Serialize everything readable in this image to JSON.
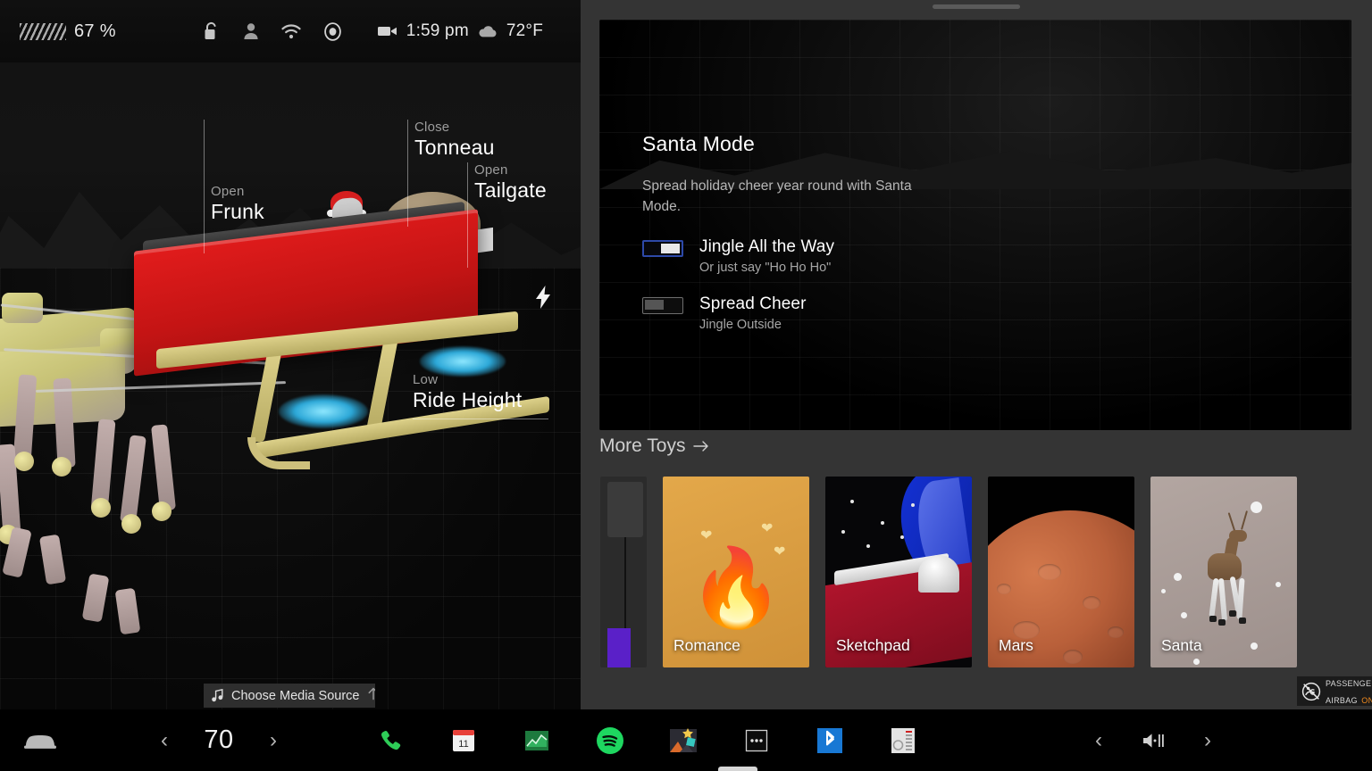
{
  "status_bar": {
    "battery_percent": "67 %",
    "battery_icon": "battery-hatch-icon",
    "lock_icon": "unlocked-padlock-icon",
    "profile_icon": "driver-profile-icon",
    "wifi_icon": "wifi-icon",
    "sentry_icon": "sentry-mode-camera-icon",
    "dashcam_icon": "dashcam-video-icon",
    "time": "1:59 pm",
    "weather_icon": "cloud-icon",
    "temperature": "72°F"
  },
  "vehicle_view": {
    "hotspots": [
      {
        "action": "Open",
        "label": "Frunk"
      },
      {
        "action": "Close",
        "label": "Tonneau"
      },
      {
        "action": "Open",
        "label": "Tailgate"
      },
      {
        "action": "Low",
        "label": "Ride Height"
      }
    ],
    "charge_port_icon": "lightning-bolt-icon"
  },
  "media_source": {
    "icon": "music-note-icon",
    "label": "Choose Media Source",
    "expand_icon": "chevron-up-icon"
  },
  "santa_mode": {
    "title": "Santa Mode",
    "description": "Spread holiday cheer year round with Santa Mode.",
    "toggles": [
      {
        "label": "Jingle All the Way",
        "sub": "Or just say \"Ho Ho Ho\"",
        "state": "on"
      },
      {
        "label": "Spread Cheer",
        "sub": "Jingle Outside",
        "state": "off"
      }
    ]
  },
  "more_toys": {
    "label": "More Toys",
    "arrow_icon": "arrow-right-icon",
    "cards": [
      {
        "title": "",
        "kind": "partial"
      },
      {
        "title": "Romance",
        "kind": "romance"
      },
      {
        "title": "Sketchpad",
        "kind": "sketchpad"
      },
      {
        "title": "Mars",
        "kind": "mars"
      },
      {
        "title": "Santa",
        "kind": "santa"
      }
    ]
  },
  "airbag_indicator": {
    "icon": "passenger-airbag-off-symbol-icon",
    "line1": "PASSENGER",
    "line2": "AIRBAG",
    "state": "ON",
    "state_color": "#f08a1e"
  },
  "bottom_bar": {
    "car_icon": "car-front-icon",
    "driver_temp": {
      "decrease_icon": "chevron-left-icon",
      "value": "70",
      "increase_icon": "chevron-right-icon"
    },
    "apps": [
      {
        "name": "phone",
        "icon": "phone-handset-icon",
        "color": "#2ecc57",
        "label": ""
      },
      {
        "name": "calendar",
        "icon": "calendar-icon",
        "color": "#e8413a",
        "label": "11"
      },
      {
        "name": "stocks",
        "icon": "stocks-chart-icon",
        "color": "#1d9b4e",
        "label": ""
      },
      {
        "name": "spotify",
        "icon": "spotify-icon",
        "color": "#1ed760",
        "label": ""
      },
      {
        "name": "toybox",
        "icon": "toybox-star-icon",
        "color": "#f2c94c",
        "label": ""
      },
      {
        "name": "more",
        "icon": "ellipsis-icon",
        "color": "#e0e0e0",
        "label": ""
      },
      {
        "name": "bluetooth",
        "icon": "bluetooth-icon",
        "color": "#1878d4",
        "label": ""
      },
      {
        "name": "tuner",
        "icon": "radio-tuner-icon",
        "color": "#d0d0d0",
        "label": ""
      }
    ],
    "volume": {
      "decrease_icon": "chevron-left-icon",
      "speaker_icon": "speaker-volume-icon",
      "increase_icon": "chevron-right-icon"
    }
  },
  "colors": {
    "accent_blue": "#2d49a8",
    "sleigh_red": "#d41a1a",
    "runner_gold": "#cdc07c",
    "thruster_blue": "#4fc3e8",
    "panel_bg": "#343434",
    "purple": "#5a20c8"
  }
}
